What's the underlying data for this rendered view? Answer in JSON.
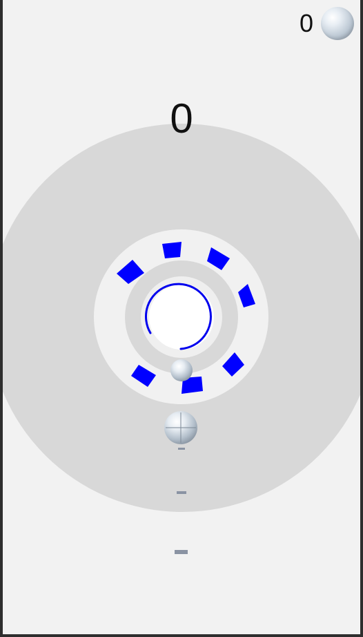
{
  "hud": {
    "coin_count": "0",
    "coin_icon": "silver-ball-icon",
    "score": "0"
  },
  "colors": {
    "screen_background": "#f2f2f2",
    "target_disc": "#d8d8d8",
    "obstacle_blocks": "#0000ff",
    "ball": "#c9d3dd"
  }
}
